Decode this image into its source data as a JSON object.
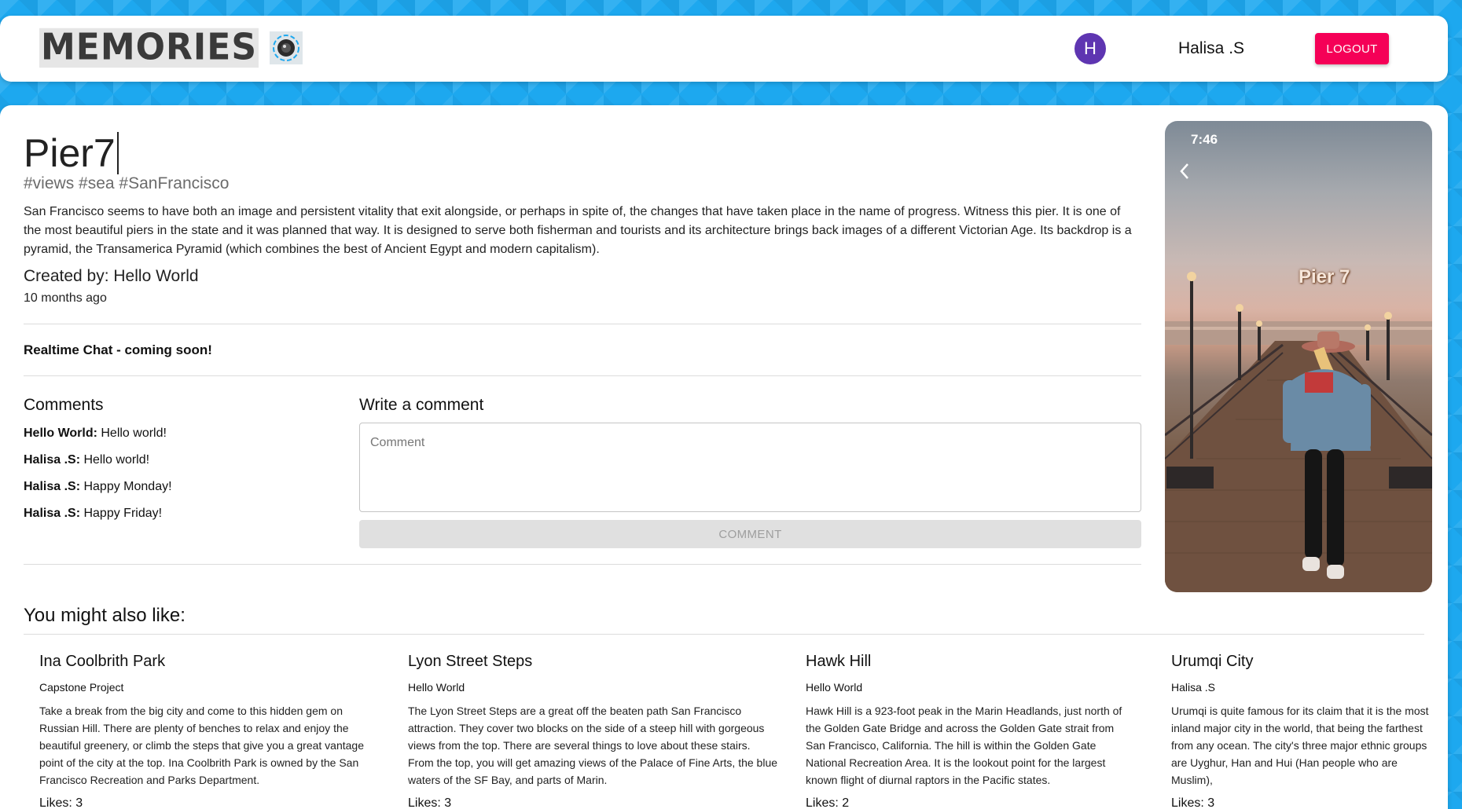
{
  "header": {
    "brand": "MEMORIES",
    "avatar_letter": "H",
    "username": "Halisa .S",
    "logout_label": "LOGOUT"
  },
  "post": {
    "title": "Pier7",
    "tags": "#views #sea #SanFrancisco",
    "description": "San Francisco seems to have both an image and persistent vitality that exit alongside, or perhaps in spite of, the changes that have taken place in the name of progress. Witness this pier. It is one of the most beautiful piers in the state and it was planned that way. It is designed to serve both fisherman and tourists and its architecture brings back images of a different Victorian Age. Its backdrop is a pyramid, the Transamerica Pyramid (which combines the best of Ancient Egypt and modern capitalism).",
    "created_by": "Created by: Hello World",
    "time_ago": "10 months ago",
    "chat_notice": "Realtime Chat - coming soon!",
    "media": {
      "time": "7:46",
      "caption": "Pier 7"
    }
  },
  "comments": {
    "heading": "Comments",
    "items": [
      {
        "author": "Hello World:",
        "text": " Hello world!"
      },
      {
        "author": "Halisa .S:",
        "text": " Hello world!"
      },
      {
        "author": "Halisa .S:",
        "text": " Happy Monday!"
      },
      {
        "author": "Halisa .S:",
        "text": " Happy Friday!"
      }
    ]
  },
  "write_comment": {
    "heading": "Write a comment",
    "placeholder": "Comment",
    "button_label": "COMMENT"
  },
  "recommendations": {
    "heading": "You might also like:",
    "items": [
      {
        "title": "Ina Coolbrith Park",
        "author": "Capstone Project",
        "description": "Take a break from the big city and come to this hidden gem on Russian Hill. There are plenty of benches to relax and enjoy the beautiful greenery, or climb the steps that give you a great vantage point of the city at the top. Ina Coolbrith Park is owned by the San Francisco Recreation and Parks Department.",
        "likes": "Likes: 3"
      },
      {
        "title": "Lyon Street Steps",
        "author": "Hello World",
        "description": "The Lyon Street Steps are a great off the beaten path San Francisco attraction. They cover two blocks on the side of a steep hill with gorgeous views from the top. There are several things to love about these stairs. From the top, you will get amazing views of the Palace of Fine Arts, the blue waters of the SF Bay, and parts of Marin.",
        "likes": "Likes: 3"
      },
      {
        "title": "Hawk Hill",
        "author": "Hello World",
        "description": "Hawk Hill is a 923-foot peak in the Marin Headlands, just north of the Golden Gate Bridge and across the Golden Gate strait from San Francisco, California. The hill is within the Golden Gate National Recreation Area. It is the lookout point for the largest known flight of diurnal raptors in the Pacific states.",
        "likes": "Likes: 2"
      },
      {
        "title": "Urumqi City",
        "author": "Halisa .S",
        "description": "Urumqi is quite famous for its claim that it is the most inland major city in the world, that being the farthest from any ocean. The city's three major ethnic groups are Uyghur, Han and Hui (Han people who are Muslim),",
        "likes": "Likes: 3"
      }
    ]
  }
}
